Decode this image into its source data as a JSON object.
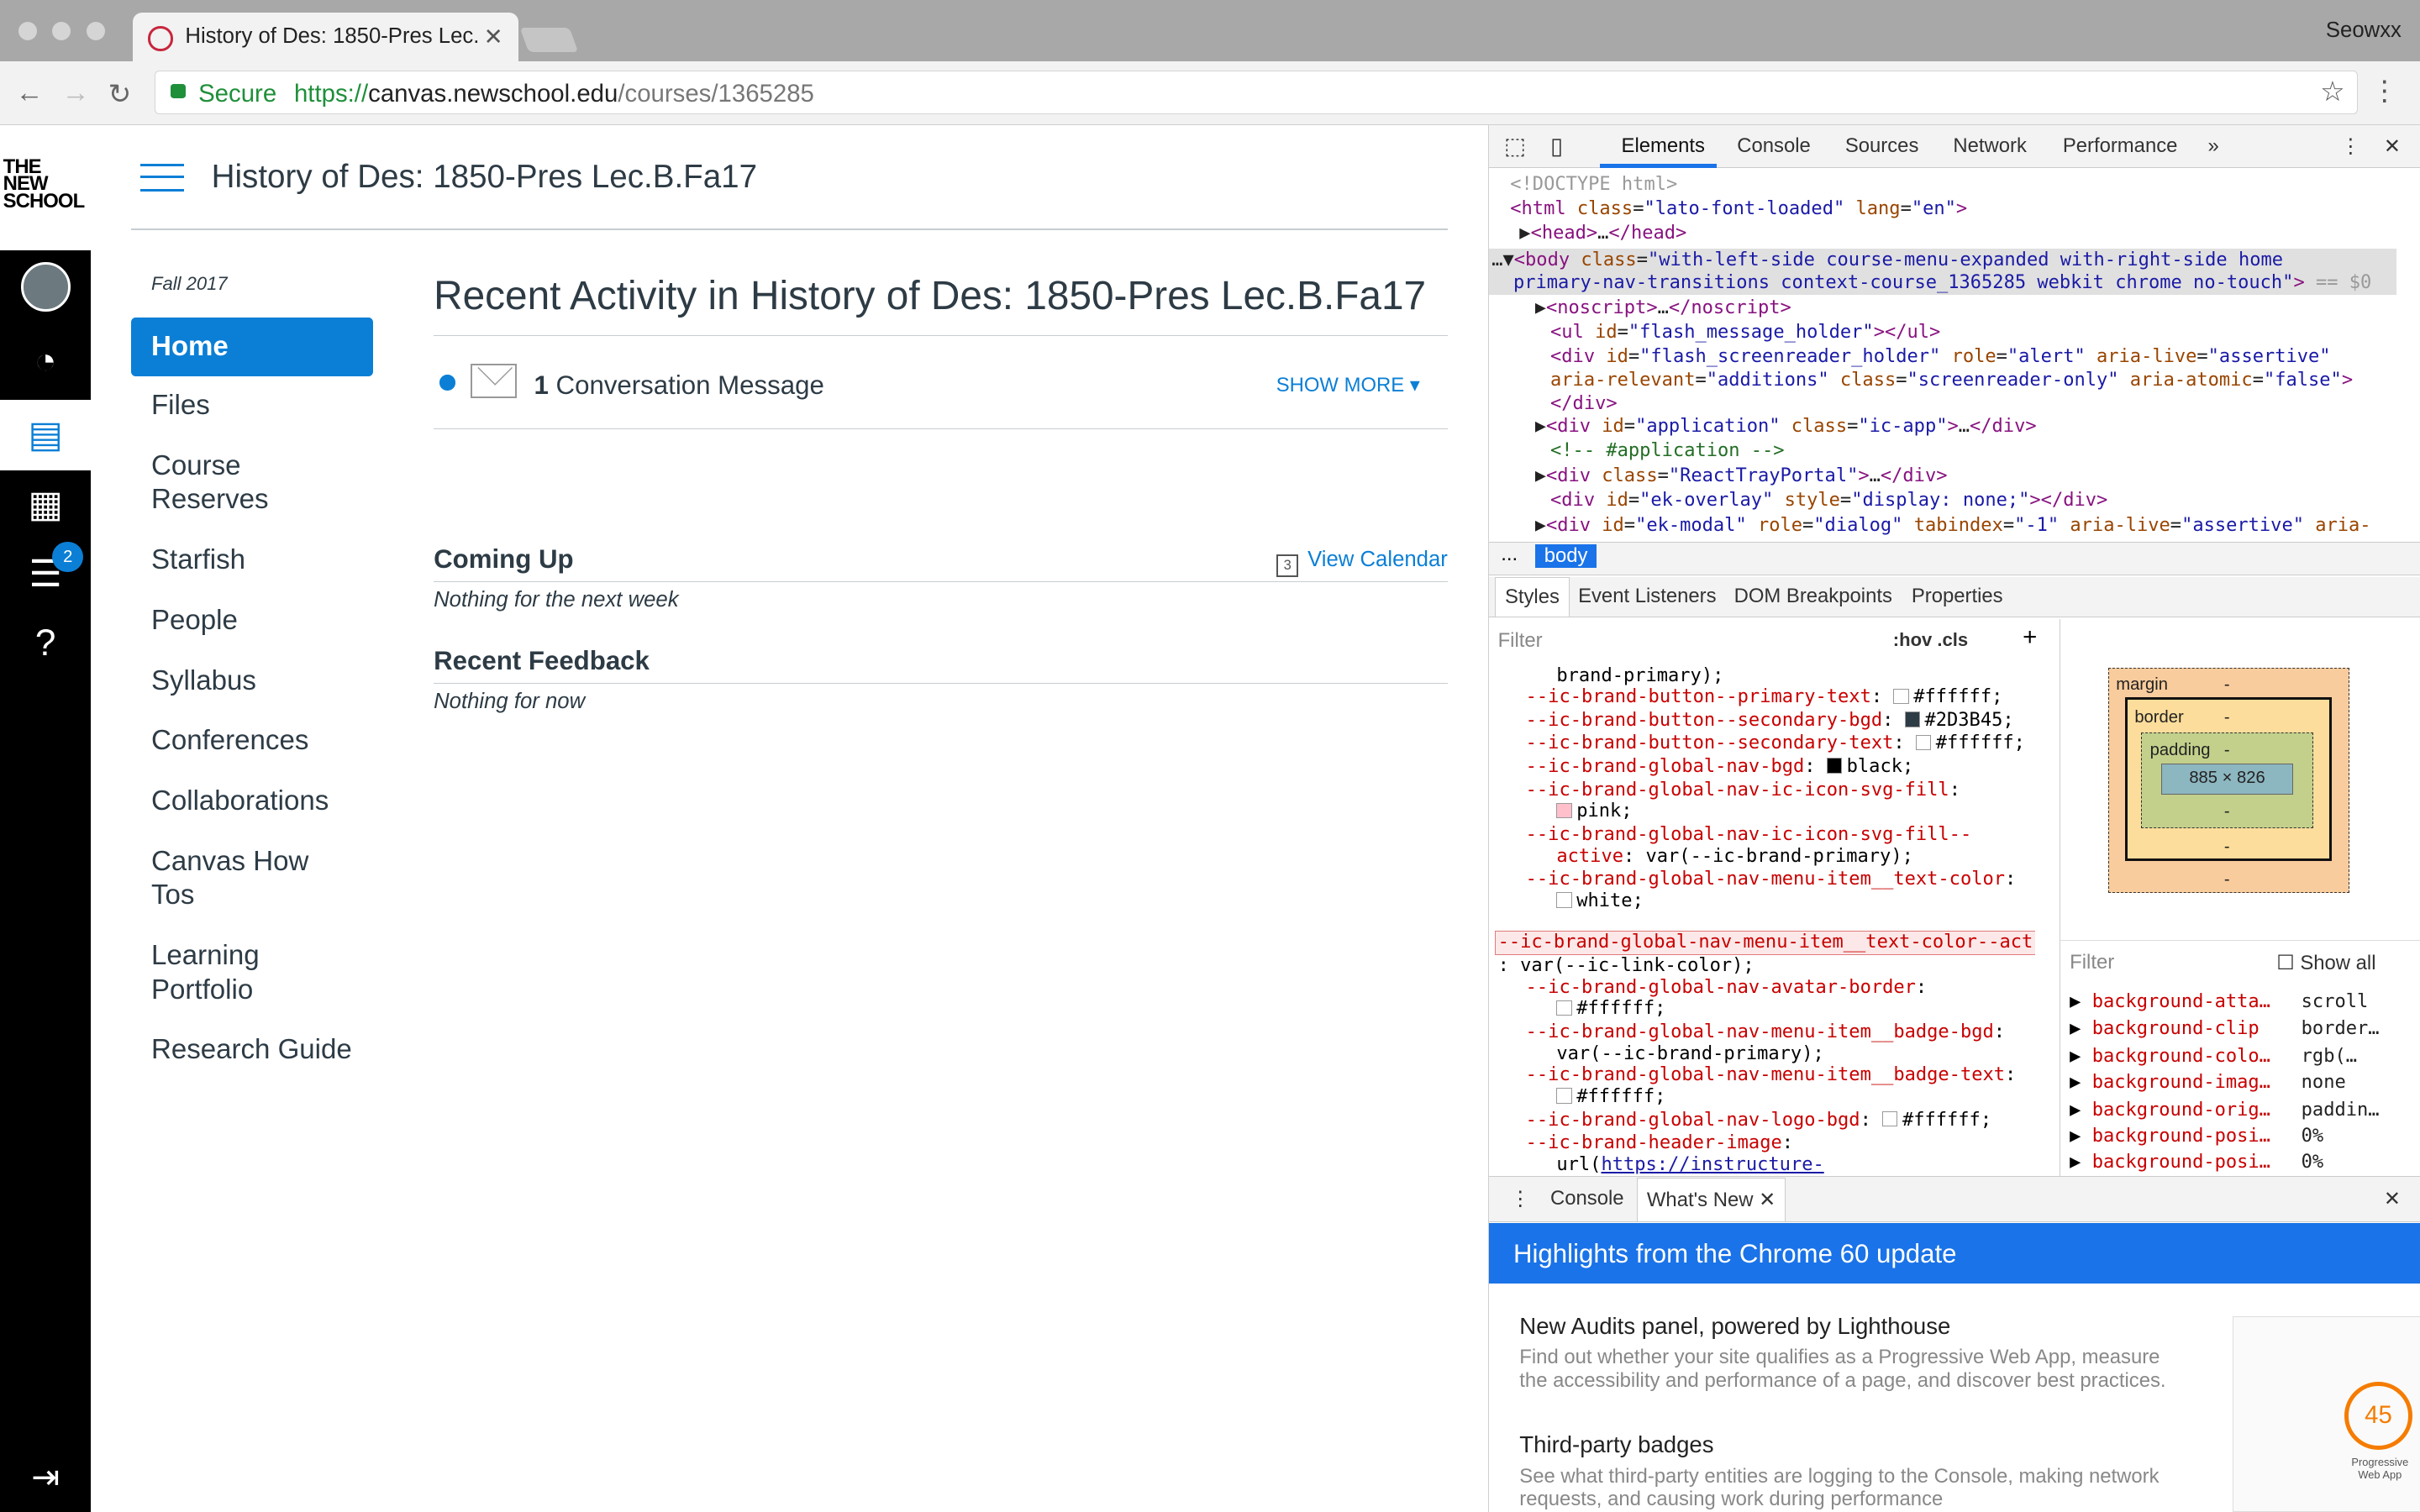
{
  "browser": {
    "tab_title": "History of Des: 1850-Pres Lec.B.Fa17",
    "profile": "Seowxx",
    "secure_label": "Secure",
    "url_scheme": "https://",
    "url_host": "canvas.newschool.edu",
    "url_path": "/courses/1365285"
  },
  "canvas": {
    "logo": "THE NEW SCHOOL",
    "course_title": "History of Des: 1850-Pres Lec.B.Fa17",
    "term": "Fall 2017",
    "inbox_badge": "2",
    "nav": [
      "Home",
      "Files",
      "Course Reserves",
      "Starfish",
      "People",
      "Syllabus",
      "Conferences",
      "Collaborations",
      "Canvas How Tos",
      "Learning Portfolio",
      "Research Guide"
    ],
    "recent_title": "Recent Activity in History of Des: 1850-Pres Lec.B.Fa17",
    "msg_count": "1",
    "msg_label": "Conversation Message",
    "show_more": "SHOW MORE",
    "coming_up": "Coming Up",
    "view_calendar": "View Calendar",
    "cal_num": "3",
    "coming_up_empty": "Nothing for the next week",
    "recent_feedback": "Recent Feedback",
    "feedback_empty": "Nothing for now"
  },
  "devtools": {
    "tabs": [
      "Elements",
      "Console",
      "Sources",
      "Network",
      "Performance"
    ],
    "more": "»",
    "crumb_dots": "...",
    "crumb": "body",
    "styles_tabs": [
      "Styles",
      "Event Listeners",
      "DOM Breakpoints",
      "Properties"
    ],
    "filter": "Filter",
    "hov": ":hov  .cls",
    "box": {
      "margin": "margin",
      "border": "border",
      "padding": "padding",
      "dash": "-",
      "content": "885 × 826"
    },
    "show_all": "Show all",
    "computed": [
      {
        "name": "background-atta…",
        "value": "scroll"
      },
      {
        "name": "background-clip",
        "value": "border…"
      },
      {
        "name": "background-colo…",
        "value": "rgb(…"
      },
      {
        "name": "background-imag…",
        "value": "none"
      },
      {
        "name": "background-orig…",
        "value": "paddin…"
      },
      {
        "name": "background-posi…",
        "value": "0%"
      },
      {
        "name": "background-posi…",
        "value": "0%"
      }
    ],
    "drawer_tabs": [
      "Console",
      "What's New"
    ],
    "whatsnew_head": "Highlights from the Chrome 60 update",
    "wn": [
      {
        "title": "New Audits panel, powered by Lighthouse",
        "body": "Find out whether your site qualifies as a Progressive Web App, measure the accessibility and performance of a page, and discover best practices."
      },
      {
        "title": "Third-party badges",
        "body": "See what third-party entities are logging to the Console, making network requests, and causing work during performance"
      }
    ],
    "thumb_score": "45",
    "thumb_label": "Progressive Web App"
  }
}
